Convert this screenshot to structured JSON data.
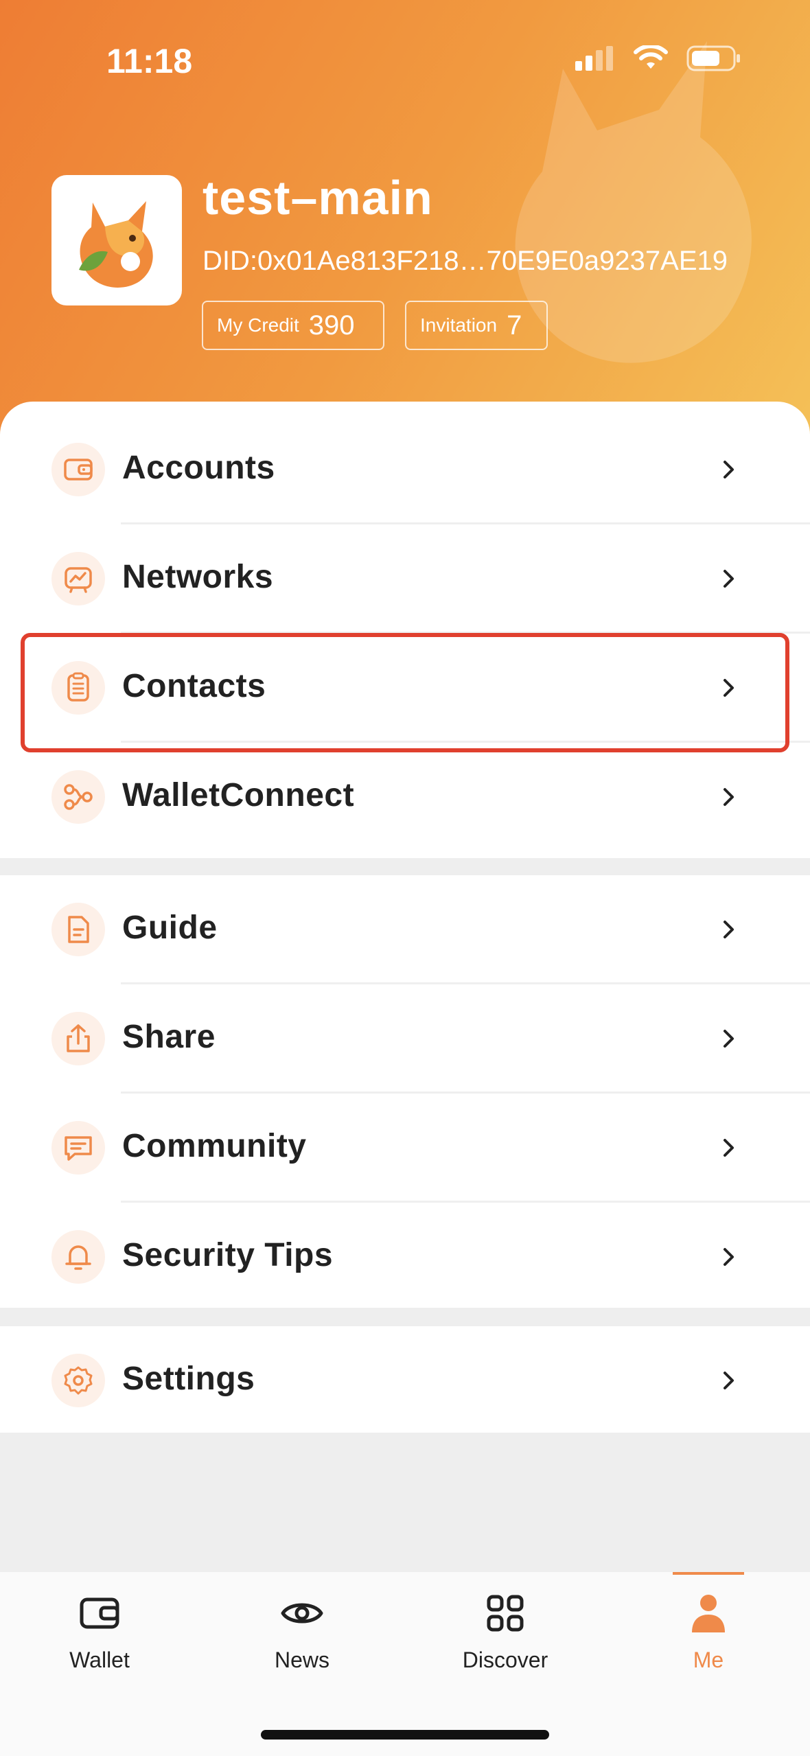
{
  "status_bar": {
    "time": "11:18"
  },
  "profile": {
    "name": "test–main",
    "did": "DID:0x01Ae813F218…70E9E0a9237AE19",
    "credit_label": "My Credit",
    "credit_value": "390",
    "invitation_label": "Invitation",
    "invitation_value": "7"
  },
  "menu": {
    "section1": [
      {
        "label": "Accounts",
        "icon": "wallet-icon"
      },
      {
        "label": "Networks",
        "icon": "network-icon"
      },
      {
        "label": "Contacts",
        "icon": "contacts-icon"
      },
      {
        "label": "WalletConnect",
        "icon": "walletconnect-icon"
      }
    ],
    "section2": [
      {
        "label": "Guide",
        "icon": "guide-icon"
      },
      {
        "label": "Share",
        "icon": "share-icon"
      },
      {
        "label": "Community",
        "icon": "community-icon"
      },
      {
        "label": "Security Tips",
        "icon": "bell-icon"
      }
    ],
    "section3": [
      {
        "label": "Settings",
        "icon": "gear-icon"
      }
    ]
  },
  "tabbar": {
    "tabs": [
      {
        "label": "Wallet",
        "icon": "wallet-tab-icon"
      },
      {
        "label": "News",
        "icon": "eye-icon"
      },
      {
        "label": "Discover",
        "icon": "grid-icon"
      },
      {
        "label": "Me",
        "icon": "person-icon",
        "active": true
      }
    ]
  },
  "colors": {
    "accent": "#ef8a4a",
    "highlight_border": "#e0402e",
    "header_gradient_start": "#ee7d34",
    "header_gradient_end": "#f4c158"
  }
}
